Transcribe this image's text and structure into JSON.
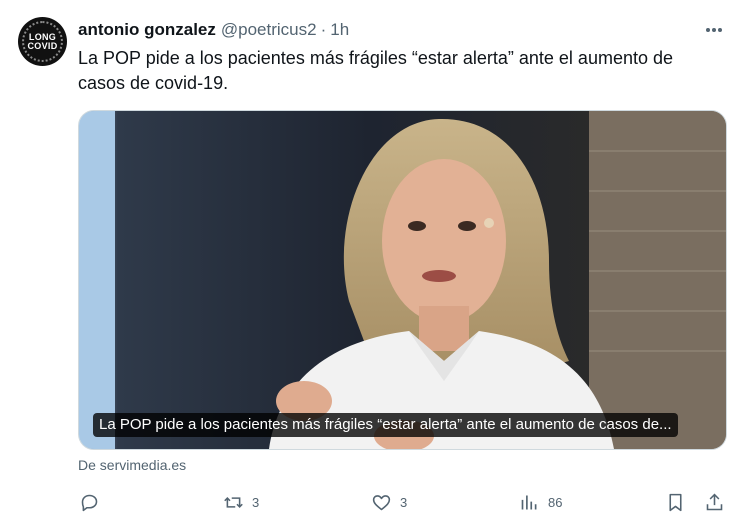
{
  "avatar": {
    "line1": "LONG",
    "line2": "COVID",
    "ring_text": "LONG COVID AWARENESS"
  },
  "tweet": {
    "author": "antonio gonzalez",
    "handle": "@poetricus2",
    "separator": "·",
    "time": "1h",
    "text": "La POP pide a los pacientes más frágiles “estar alerta” ante el aumento de casos de covid-19."
  },
  "card": {
    "caption": "La POP pide a los pacientes más frágiles “estar alerta” ante el aumento de casos de...",
    "source": "De servimedia.es"
  },
  "actions": {
    "reply_count": "",
    "retweet_count": "3",
    "like_count": "3",
    "views_count": "86"
  },
  "icons": [
    "more-icon",
    "reply-icon",
    "retweet-icon",
    "like-icon",
    "views-icon",
    "bookmark-icon",
    "share-icon"
  ],
  "colors": {
    "text": "#0f1419",
    "secondary": "#536471",
    "border": "#cfd9de"
  }
}
